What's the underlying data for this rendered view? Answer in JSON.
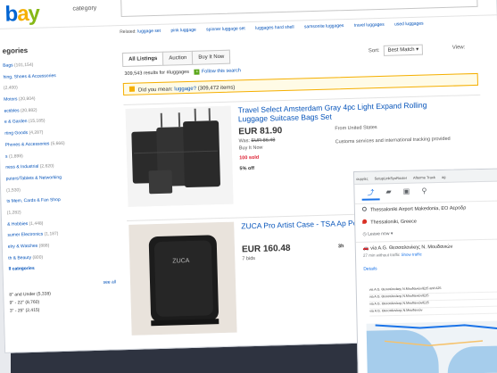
{
  "ebay": {
    "logo": {
      "b": "b",
      "a": "a",
      "y": "y"
    },
    "category_label": "category",
    "related_label": "Related:",
    "related": [
      "luggage set",
      "pink luggage",
      "spinner luggage set",
      "luggages hard shell",
      "samsonite luggages",
      "travel luggages",
      "used luggages"
    ],
    "sidebar": {
      "title": "egories",
      "categories": [
        {
          "label": "Bags",
          "count": "(101,154)"
        },
        {
          "label": "hing, Shoes & Accessories",
          "count": ""
        },
        {
          "label": "",
          "count": "(2,400)"
        },
        {
          "label": "Motors",
          "count": "(20,804)"
        },
        {
          "label": "ectibles",
          "count": "(20,882)"
        },
        {
          "label": "e & Garden",
          "count": "(15,185)"
        },
        {
          "label": "rting Goods",
          "count": "(4,287)"
        },
        {
          "label": "Phones & Accessories",
          "count": "(5,666)"
        },
        {
          "label": "s",
          "count": "(1,898)"
        },
        {
          "label": "ness & Industrial",
          "count": "(2,620)"
        },
        {
          "label": "puters/Tablets & Networking",
          "count": ""
        },
        {
          "label": "",
          "count": "(1,530)"
        },
        {
          "label": "ts Mem, Cards & Fan Shop",
          "count": ""
        },
        {
          "label": "",
          "count": "(1,282)"
        },
        {
          "label": "& Hobbies",
          "count": "(1,448)"
        },
        {
          "label": "sumer Electronics",
          "count": "(1,187)"
        },
        {
          "label": "elry & Watches",
          "count": "(888)"
        },
        {
          "label": "th & Beauty",
          "count": "(800)"
        }
      ],
      "all_label": "ll categories",
      "size_title": "",
      "see_all": "see all",
      "sizes": [
        "8\" and Under (5,338)",
        "9\" - 22\" (8,760)",
        "3\" - 25\" (2,415)"
      ]
    },
    "tabs": [
      "All Listings",
      "Auction",
      "Buy It Now"
    ],
    "sort_label": "Sort:",
    "sort_value": "Best Match",
    "view_label": "View:",
    "results_count": "309,543 results for #luggages",
    "follow": "Follow this search",
    "did_you_mean": {
      "prefix": "Did you mean:",
      "query": "luggage?",
      "suffix": "(309,472 items)"
    },
    "items": [
      {
        "title": "Travel Select Amsterdam Gray 4pc Light Expand Rolling Luggage Suitcase Bags Set",
        "price": "EUR 81.90",
        "was_label": "Was:",
        "was_price": "EUR 86.48",
        "format": "Buy It Now",
        "sold": "100 sold",
        "off": "5% off",
        "from": "From United States",
        "customs": "Customs services and international tracking provided"
      },
      {
        "title": "ZUCA Pro Artist Case - TSA Ap Polyurethane",
        "price": "EUR 160.48",
        "bids": "7 bids",
        "time": "3h"
      }
    ]
  },
  "maps": {
    "bookmarks": [
      "ουργίες",
      "SetupLinkSysRouter",
      "Afterme Track",
      "ag"
    ],
    "mode_icons": [
      "directions-icon",
      "car-icon",
      "transit-icon",
      "walk-icon"
    ],
    "origin": "Thessaloniki Airport Makedonia, EO Αεροδρ",
    "destination": "Thessaloniki, Greece",
    "leave_now": "Leave now",
    "route_via": "via A.G. Θεσσαλονίκης Ν. Μουδανιών",
    "route_sub": "27 min without traffic",
    "route_link": "Show traffic",
    "details": "Details",
    "steps": [
      "via A.G. Θεσσαλονίκης Ν.Μουδανιών/E25 and A25",
      "via A.G. Θεσσαλονίκης Ν.Μουδανιών/E25",
      "via A.G. Θεσσαλονίκης Ν.Μουδανιών/E25",
      "via A.G. Θεσσαλονίκης Ν.Μουδανιών"
    ]
  }
}
